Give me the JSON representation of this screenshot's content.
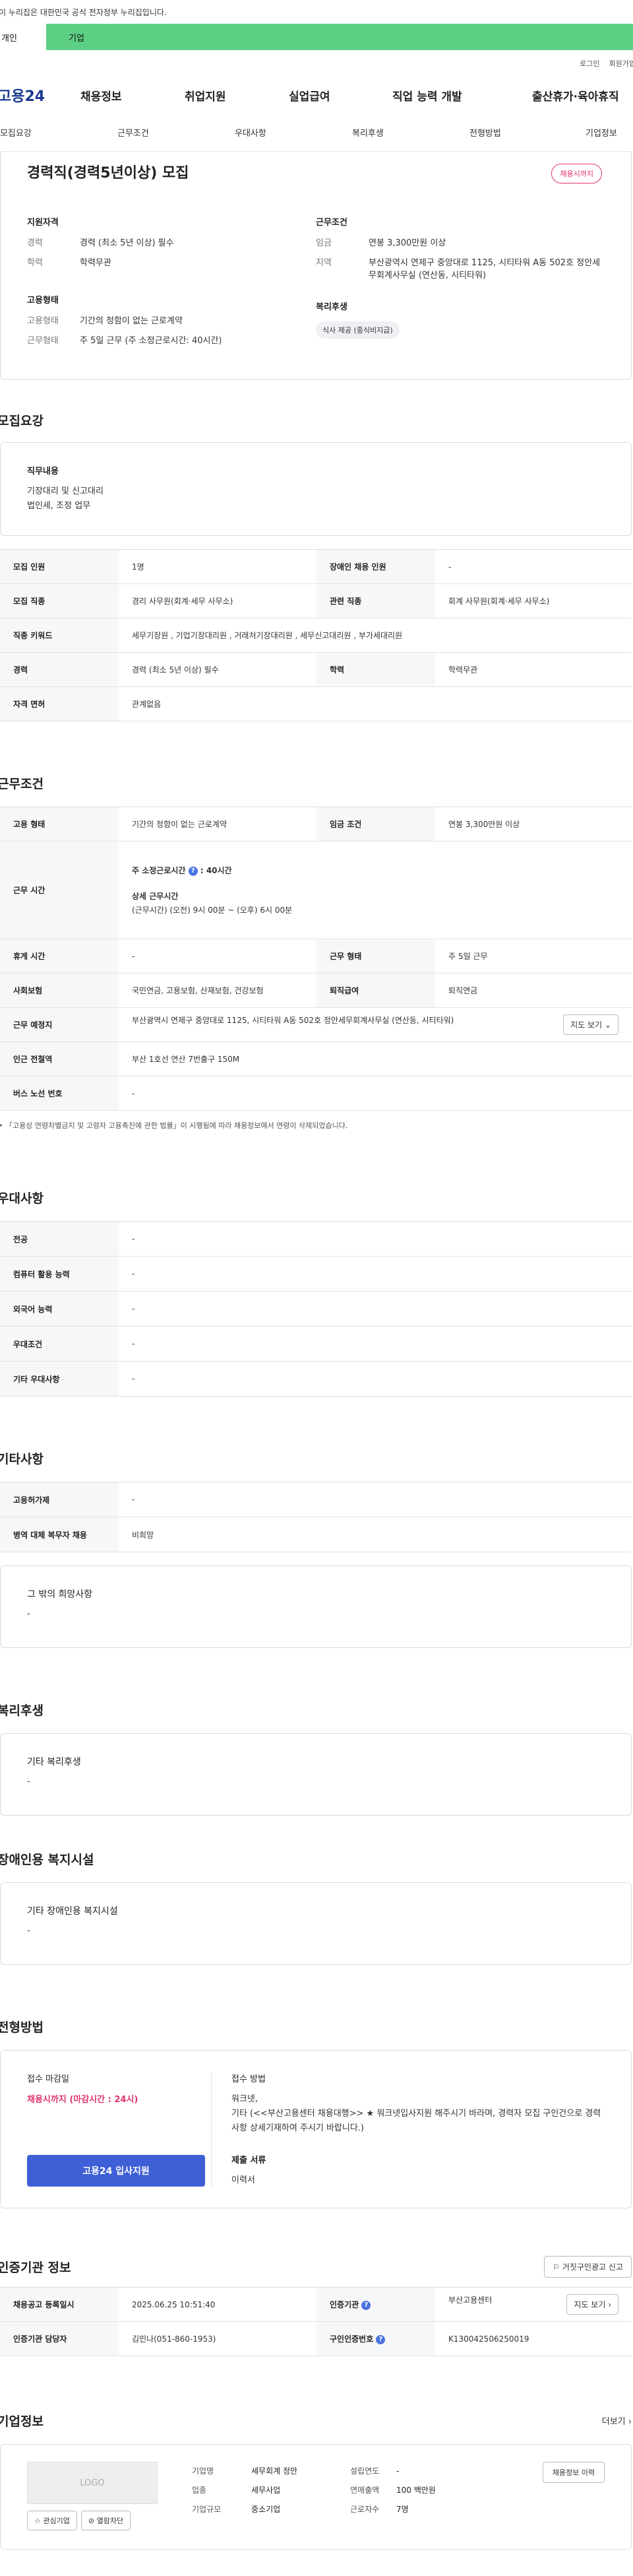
{
  "gov_banner": "이 누리집은 대한민국 공식 전자정부 누리집입니다.",
  "tabs": [
    "개인",
    "기업"
  ],
  "util": {
    "login": "로그인",
    "signup": "회원가입"
  },
  "gnb": {
    "logo": "고용24",
    "items": [
      "채용정보",
      "취업지원",
      "실업급여",
      "직업 능력 개발",
      "출산휴가·육아휴직"
    ]
  },
  "subnav": [
    "모집요강",
    "근무조건",
    "우대사항",
    "복리후생",
    "전형방법",
    "기업정보"
  ],
  "summary": {
    "title": "경력직(경력5년이상) 모집",
    "badge": "채용시까지",
    "left_title": "지원자격",
    "career_k": "경력",
    "career_v": "경력 (최소 5년 이상) 필수",
    "edu_k": "학력",
    "edu_v": "학력무관",
    "right_title": "근무조건",
    "wage_k": "임금",
    "wage_v": "연봉 3,300만원 이상",
    "area_k": "지역",
    "area_v": "부산광역시 연제구 중앙대로 1125, 시티타워 A동 502호 정안세무회계사무실 (연산동, 시티타워)",
    "emp_title": "고용형태",
    "emp_k": "고용형태",
    "emp_v": "기간의 정함이 없는 근로계약",
    "work_k": "근무형태",
    "work_v": "주 5일 근무 (주 소정근로시간: 40시간)",
    "welfare_title": "복리후생",
    "welfare_chip": "식사 제공 (중식비지급)"
  },
  "recruit": {
    "title": "모집요강",
    "job_title": "직무내용",
    "job_lines": [
      "기장대리 및 신고대리",
      "법인세, 조정 업무"
    ],
    "rows": {
      "count_k": "모집 인원",
      "count_v": "1명",
      "disabled_k": "장애인 채용 인원",
      "disabled_v": "-",
      "job_k": "모집 직종",
      "job_v": "경리 사무원(회계·세무 사무소)",
      "rel_k": "관련 직종",
      "rel_v": "회계 사무원(회계·세무 사무소)",
      "kw_k": "직종 키워드",
      "kw_v": "세무기장원 , 기업기장대리원 , 거래처기장대리원 , 세무신고대리원 , 부가세대리원",
      "car_k": "경력",
      "car_v": "경력 (최소 5년 이상) 필수",
      "edu_k": "학력",
      "edu_v": "학력무관",
      "lic_k": "자격 면허",
      "lic_v": "관계없음"
    }
  },
  "cond": {
    "title": "근무조건",
    "type_k": "고용 형태",
    "type_v": "기간의 정함이 없는 근로계약",
    "wage_k": "임금 조건",
    "wage_v": "연봉 3,300만원 이상",
    "time_k": "근무 시간",
    "time_weekly_label": "주 소정근로시간",
    "time_weekly_val": ": 40시간",
    "time_detail_label": "상세 근무시간",
    "time_detail_val": "(근무시간) (오전) 9시 00분 ~ (오후) 6시 00분",
    "rest_k": "휴게 시간",
    "rest_v": "-",
    "form_k": "근무 형태",
    "form_v": "주 5일 근무",
    "ins_k": "사회보험",
    "ins_v": "국민연금, 고용보험, 산재보험, 건강보험",
    "ret_k": "퇴직급여",
    "ret_v": "퇴직연금",
    "addr_k": "근무 예정지",
    "addr_v": "부산광역시 연제구 중앙대로 1125, 시티타워 A동 502호 정안세무회계사무실 (연산동, 시티타워)",
    "map_btn": "지도 보기",
    "sub_k": "인근 전철역",
    "sub_v": "부산 1호선 연산 7번출구 150M",
    "bus_k": "버스 노선 번호",
    "bus_v": "-",
    "note": "「고용상 연령차별금지 및 고령자 고용촉진에 관한 법률」이 시행됨에 따라 채용정보에서 연령이 삭제되었습니다."
  },
  "pref": {
    "title": "우대사항",
    "rows": [
      {
        "k": "전공",
        "v": "-"
      },
      {
        "k": "컴퓨터 활용 능력",
        "v": "-"
      },
      {
        "k": "외국어 능력",
        "v": "-"
      },
      {
        "k": "우대조건",
        "v": "-"
      },
      {
        "k": "기타 우대사항",
        "v": "-"
      }
    ]
  },
  "etc": {
    "title": "기타사항",
    "rows": [
      {
        "k": "고용허가제",
        "v": "-"
      },
      {
        "k": "병역 대체 복무자 채용",
        "v": "비희망"
      }
    ],
    "wish_title": "그 밖의 희망사항",
    "wish_v": "-"
  },
  "welfare": {
    "title": "복리후생",
    "box_title": "기타 복리후생",
    "box_v": "-"
  },
  "disabled": {
    "title": "장애인용 복지시설",
    "box_title": "기타 장애인용 복지시설",
    "box_v": "-"
  },
  "apply": {
    "title": "전형방법",
    "deadline_label": "접수 마감일",
    "deadline_v": "채용시까지 (마감시간 : 24시)",
    "apply_btn": "고용24 입사지원",
    "method_label": "접수 방법",
    "method_l1": "워크넷,",
    "method_l2": "기타 (<<부산고용센터 채용대행>> ★ 워크넷입사지원 해주시기 바라며, 경력자 모집 구인건으로 경력사항 상세기재하여 주시기 바랍니다.)",
    "docs_label": "제출 서류",
    "docs_v": "이력서"
  },
  "cert": {
    "title": "인증기관 정보",
    "report_btn": "거짓구인광고 신고",
    "reg_k": "채용공고 등록일시",
    "reg_v": "2025.06.25 10:51:40",
    "org_k": "인증기관",
    "org_v": "부산고용센터",
    "map_btn": "지도 보기",
    "mgr_k": "인증기관 담당자",
    "mgr_v": "김민나(051-860-1953)",
    "num_k": "구인인증번호",
    "num_v": "K130042506250019"
  },
  "company": {
    "title": "기업정보",
    "more": "더보기",
    "logo": "LOGO",
    "fav_btn": "관심기업",
    "block_btn": "열람차단",
    "name_k": "기업명",
    "name_v": "세무회계 정안",
    "year_k": "설립연도",
    "year_v": "-",
    "ind_k": "업종",
    "ind_v": "세무사업",
    "sales_k": "연매출액",
    "sales_v": "100 백만원",
    "size_k": "기업규모",
    "size_v": "중소기업",
    "emp_k": "근로자수",
    "emp_v": "7명",
    "history_btn": "채용정보 이력"
  }
}
